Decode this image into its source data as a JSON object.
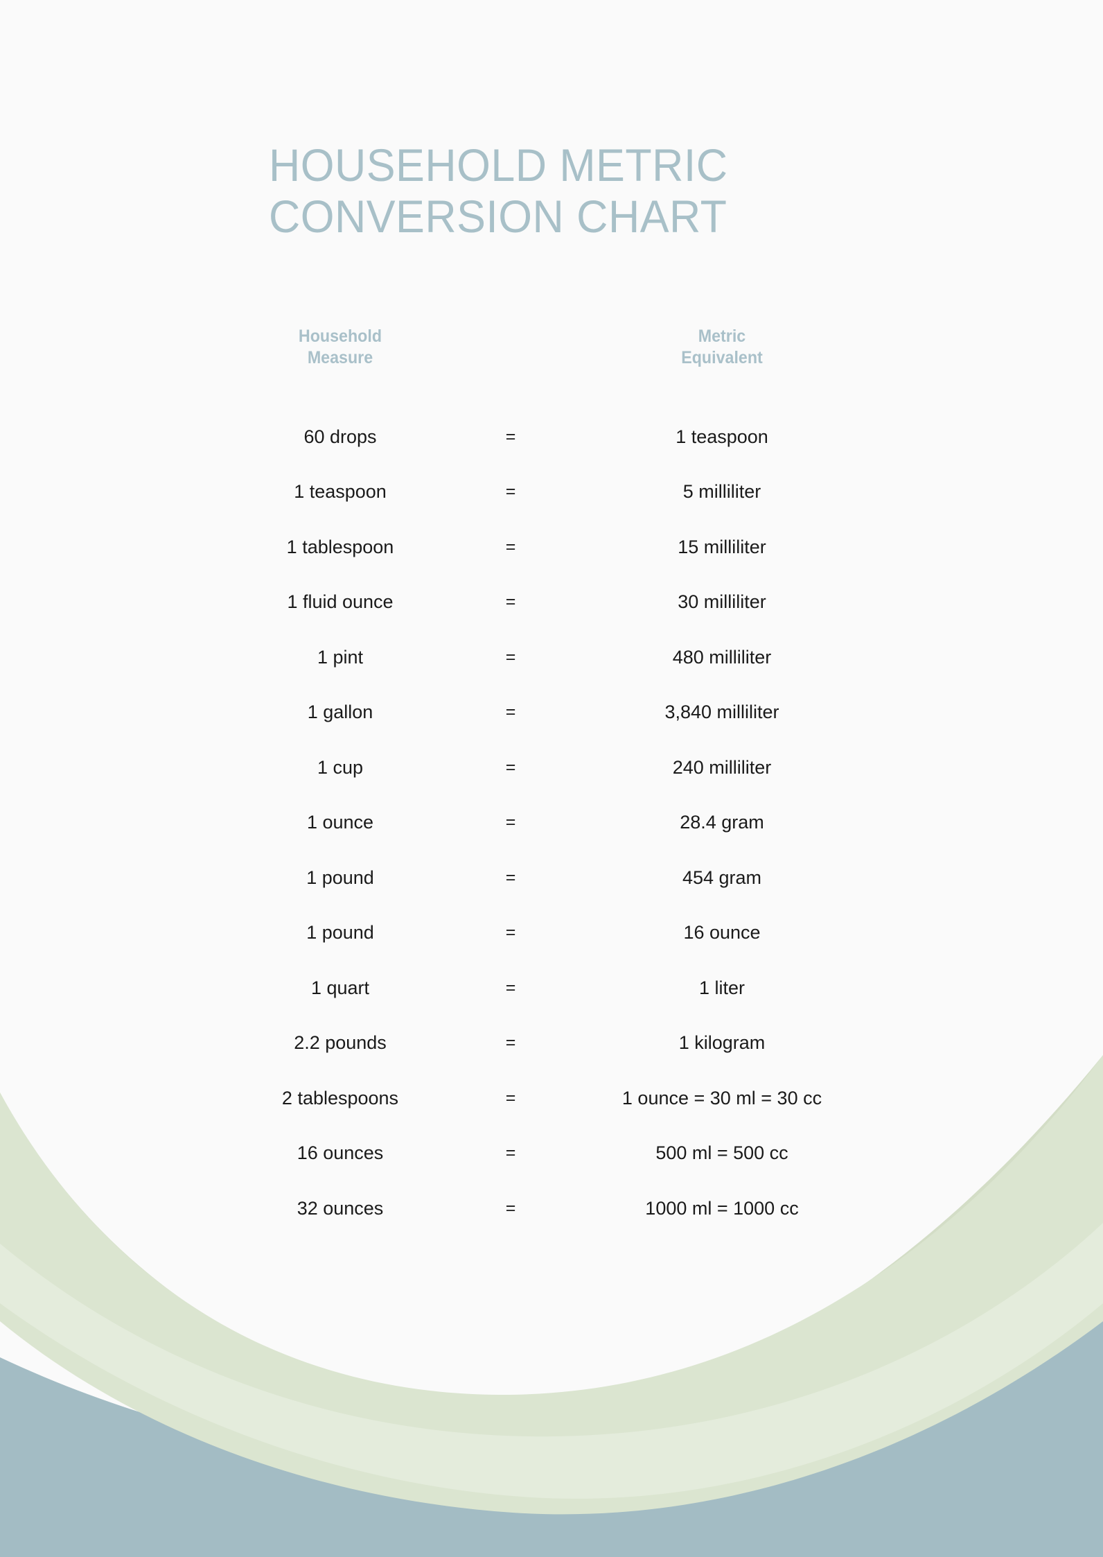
{
  "document": {
    "title": "HOUSEHOLD METRIC\nCONVERSION CHART",
    "background_color": "#fafafa",
    "title_color": "#a8c0c8",
    "header_color": "#a9c0c9",
    "body_text_color": "#1a1a1a",
    "decor_green": "#dbe5d0",
    "decor_green_light": "#e2ead9",
    "decor_blue": "#a3bcc4"
  },
  "table": {
    "headers": {
      "left": "Household\nMeasure",
      "middle": "",
      "right": "Metric\nEquivalent"
    },
    "equals_symbol": "=",
    "rows": [
      {
        "measure": "60 drops",
        "eq": "=",
        "equivalent": "1 teaspoon"
      },
      {
        "measure": "1 teaspoon",
        "eq": "=",
        "equivalent": "5 milliliter"
      },
      {
        "measure": "1 tablespoon",
        "eq": "=",
        "equivalent": "15 milliliter"
      },
      {
        "measure": "1 fluid ounce",
        "eq": "=",
        "equivalent": "30 milliliter"
      },
      {
        "measure": "1 pint",
        "eq": "=",
        "equivalent": "480 milliliter"
      },
      {
        "measure": "1 gallon",
        "eq": "=",
        "equivalent": "3,840 milliliter"
      },
      {
        "measure": "1 cup",
        "eq": "=",
        "equivalent": "240 milliliter"
      },
      {
        "measure": "1 ounce",
        "eq": "=",
        "equivalent": "28.4 gram"
      },
      {
        "measure": "1 pound",
        "eq": "=",
        "equivalent": "454 gram"
      },
      {
        "measure": "1 pound",
        "eq": "=",
        "equivalent": "16 ounce"
      },
      {
        "measure": "1 quart",
        "eq": "=",
        "equivalent": "1 liter"
      },
      {
        "measure": "2.2 pounds",
        "eq": "=",
        "equivalent": "1 kilogram"
      },
      {
        "measure": "2 tablespoons",
        "eq": "=",
        "equivalent": "1 ounce = 30 ml = 30 cc"
      },
      {
        "measure": "16 ounces",
        "eq": "=",
        "equivalent": "500 ml = 500 cc"
      },
      {
        "measure": "32 ounces",
        "eq": "=",
        "equivalent": "1000 ml = 1000 cc"
      }
    ]
  }
}
